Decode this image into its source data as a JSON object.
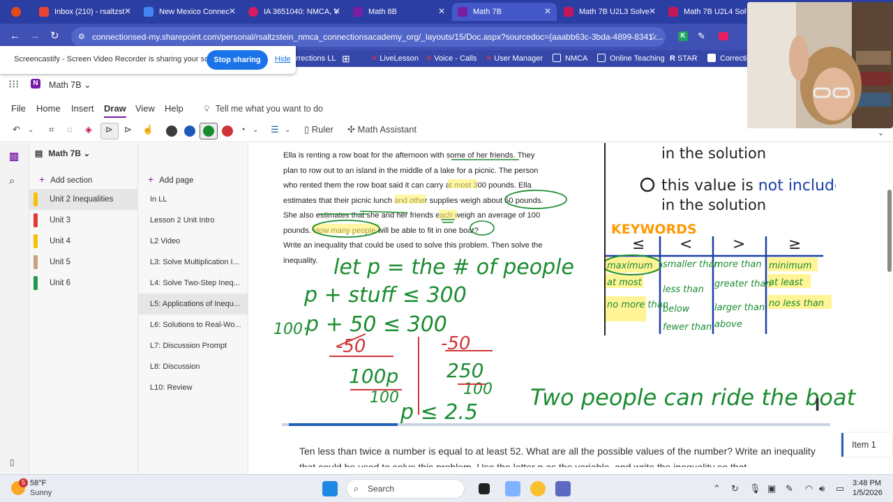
{
  "tabs": [
    {
      "label": "",
      "color": "#e64a19"
    },
    {
      "label": "Inbox (210) - rsaltzst",
      "color": "#ea4335"
    },
    {
      "label": "New Mexico Connec",
      "color": "#4285f4"
    },
    {
      "label": "IA 3651040: NMCA, V",
      "color": "#d81b60"
    },
    {
      "label": "Math 8B",
      "color": "#7b1fa2"
    },
    {
      "label": "Math 7B",
      "color": "#7b1fa2"
    },
    {
      "label": "Math 7B U2L3 Solve",
      "color": "#c2185b"
    },
    {
      "label": "Math 7B U2L4 Solve",
      "color": "#c2185b"
    }
  ],
  "address": {
    "url": "connectionsed-my.sharepoint.com/personal/rsaltzstein_nmca_connectionsacademy_org/_layouts/15/Doc.aspx?sourcedoc={aaabb63c-3bda-4899-8341-..."
  },
  "bookmarks": [
    "rrections LL",
    "LiveLesson",
    "Voice - Calls",
    "User Manager",
    "NMCA",
    "Online Teaching",
    "STAR",
    "Correctio"
  ],
  "screencastify": {
    "message": "Screencastify - Screen Video Recorder is sharing your screen.",
    "stop_label": "Stop sharing",
    "hide_label": "Hide"
  },
  "app": {
    "notebook_title": "Math 7B",
    "notebook_menu": "Math 7B"
  },
  "menus": [
    "File",
    "Home",
    "Insert",
    "Draw",
    "View",
    "Help"
  ],
  "tell_me": "Tell me what you want to do",
  "ribbon": {
    "ruler": "Ruler",
    "assistant": "Math Assistant"
  },
  "sections": {
    "add_label": "Add section",
    "items": [
      {
        "label": "Unit 2 Inequalities",
        "color": "#f4c20d"
      },
      {
        "label": "Unit 3",
        "color": "#e53935"
      },
      {
        "label": "Unit 4",
        "color": "#f4c20d"
      },
      {
        "label": "Unit 5",
        "color": "#c9a27e"
      },
      {
        "label": "Unit 6",
        "color": "#1e9a4e"
      }
    ]
  },
  "pages": {
    "add_label": "Add page",
    "items": [
      "In LL",
      "Lesson 2 Unit Intro",
      "L2 Video",
      "L3: Solve Multiplication I...",
      "L4: Solve Two-Step Ineq...",
      "L5: Applications of Inequ...",
      "L6: Solutions to Real-Wo...",
      "L7: Discussion Prompt",
      "L8: Discussion",
      "L10: Review"
    ]
  },
  "problem": {
    "lines": [
      "Ella is renting a row boat for the afternoon with some of her friends. They",
      "plan to row out to an island in the middle of a lake for a picnic. The person",
      "who rented them the row boat said it can carry at most 300 pounds. Ella",
      "estimates that their picnic lunch and other supplies weigh about 50 pounds.",
      "She also estimates that she and her friends each weigh an average of 100",
      "pounds. How many people will be able to fit in one boat?",
      "Write an inequality that could be used to solve this problem. Then solve the",
      "inequality."
    ]
  },
  "handwriting": {
    "let_line": "let p = the # of people",
    "line2": "p + stuff ≤ 300",
    "line3_coef": "100·",
    "line3": "p + 50 ≤ 300",
    "sub_left": "-50",
    "sub_right": "-50",
    "div_left_top": "100p",
    "div_right_top": "250",
    "div_left_bot": "100",
    "div_right_bot": "100",
    "result": "p ≤ 2.5",
    "answer": "Two people can ride the boat"
  },
  "anchor_chart": {
    "line1": "in the solution",
    "line2a": "this value is ",
    "line2b": "not included",
    "line3": "in the solution",
    "keywords_title": "KEYWORDS",
    "symbols": [
      "≤",
      "<",
      ">",
      "≥"
    ],
    "col1": [
      "maximum",
      "at most",
      "no more than"
    ],
    "col2": [
      "smaller than",
      "less than",
      "below",
      "fewer than"
    ],
    "col3": [
      "more than",
      "greater than",
      "larger than",
      "above"
    ],
    "col4": [
      "minimum",
      "at least",
      "no less than"
    ]
  },
  "next_question": {
    "text": "Ten less than twice a number is equal to at least 52. What are all the possible values of the number? Write an inequality that could be used to solve this problem. Use the letter n as the variable, and write the inequality so that",
    "item_label": "Item 1"
  },
  "taskbar": {
    "weather_temp": "58°F",
    "weather_desc": "Sunny",
    "badge": "5",
    "search": "Search",
    "time": "3:48 PM",
    "date": "1/5/2026"
  }
}
